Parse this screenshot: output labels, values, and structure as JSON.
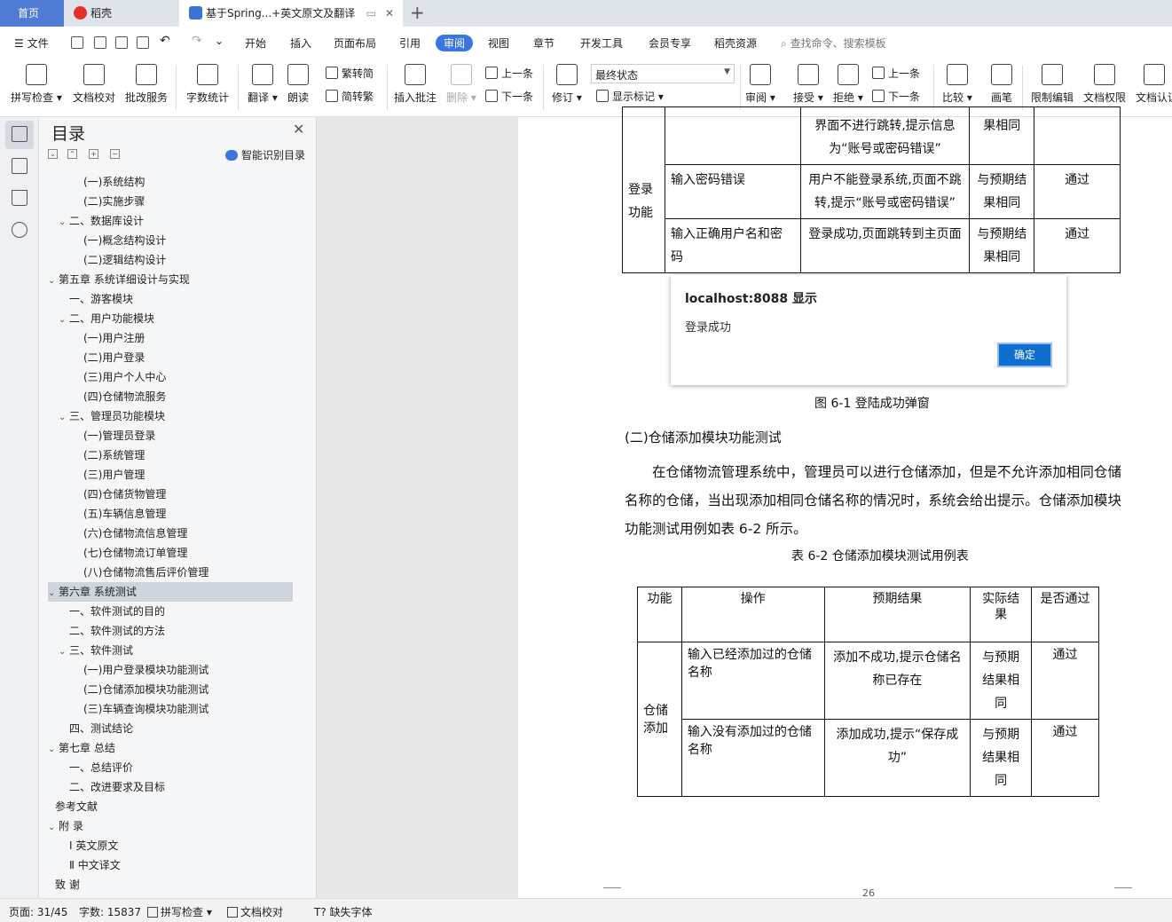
{
  "tabs": {
    "home": "首页",
    "docer": "稻壳",
    "doc": "基于Spring...+英文原文及翻译"
  },
  "menu": {
    "file": "文件",
    "items": [
      "开始",
      "插入",
      "页面布局",
      "引用",
      "审阅",
      "视图",
      "章节",
      "开发工具",
      "会员专享",
      "稻壳资源"
    ],
    "search_placeholder": "查找命令、搜索模板"
  },
  "ribbon": {
    "spell_check": "拼写检查",
    "doc_proof": "文档校对",
    "batch_service": "批改服务",
    "word_count": "字数统计",
    "translate": "翻译",
    "read_aloud": "朗读",
    "trad_conv": "繁转简",
    "simp_conv": "简转繁",
    "insert_comment": "插入批注",
    "delete": "删除",
    "prev_item": "上一条",
    "next_item": "下一条",
    "revise": "修订",
    "final_state": "最终状态",
    "show_marks": "显示标记",
    "review": "审阅",
    "accept": "接受",
    "reject": "拒绝",
    "prev_change": "上一条",
    "next_change": "下一条",
    "compare": "比较",
    "pen": "画笔",
    "restrict_edit": "限制编辑",
    "doc_rights": "文档权限",
    "doc_cert": "文档认证"
  },
  "toc": {
    "title": "目录",
    "smart": "智能识别目录",
    "items": [
      {
        "text": "(一)系统结构",
        "level": 3
      },
      {
        "text": "(二)实施步骤",
        "level": 3
      },
      {
        "text": "二、数据库设计",
        "level": 2,
        "chev": true
      },
      {
        "text": "(一)概念结构设计",
        "level": 3
      },
      {
        "text": "(二)逻辑结构设计",
        "level": 3
      },
      {
        "text": "第五章  系统详细设计与实现",
        "level": 1,
        "chev": true
      },
      {
        "text": "一、游客模块",
        "level": 2
      },
      {
        "text": "二、用户功能模块",
        "level": 2,
        "chev": true
      },
      {
        "text": "(一)用户注册",
        "level": 3
      },
      {
        "text": "(二)用户登录",
        "level": 3
      },
      {
        "text": "(三)用户个人中心",
        "level": 3
      },
      {
        "text": "(四)仓储物流服务",
        "level": 3
      },
      {
        "text": "三、管理员功能模块",
        "level": 2,
        "chev": true
      },
      {
        "text": "(一)管理员登录",
        "level": 3
      },
      {
        "text": "(二)系统管理",
        "level": 3
      },
      {
        "text": "(三)用户管理",
        "level": 3
      },
      {
        "text": "(四)仓储货物管理",
        "level": 3
      },
      {
        "text": "(五)车辆信息管理",
        "level": 3
      },
      {
        "text": "(六)仓储物流信息管理",
        "level": 3
      },
      {
        "text": "(七)仓储物流订单管理",
        "level": 3
      },
      {
        "text": "(八)仓储物流售后评价管理",
        "level": 3
      },
      {
        "text": "第六章  系统测试",
        "level": 1,
        "chev": true,
        "selected": true
      },
      {
        "text": "一、软件测试的目的",
        "level": 2
      },
      {
        "text": "二、软件测试的方法",
        "level": 2
      },
      {
        "text": "三、软件测试",
        "level": 2,
        "chev": true
      },
      {
        "text": "(一)用户登录模块功能测试",
        "level": 3
      },
      {
        "text": "(二)仓储添加模块功能测试",
        "level": 3
      },
      {
        "text": "(三)车辆查询模块功能测试",
        "level": 3
      },
      {
        "text": "四、测试结论",
        "level": 2
      },
      {
        "text": "第七章  总结",
        "level": 1,
        "chev": true
      },
      {
        "text": "一、总结评价",
        "level": 2
      },
      {
        "text": "二、改进要求及目标",
        "level": 2
      },
      {
        "text": "参考文献",
        "level": 1
      },
      {
        "text": "附    录",
        "level": 1,
        "chev": true
      },
      {
        "text": "Ⅰ 英文原文",
        "level": 2
      },
      {
        "text": "Ⅱ 中文译文",
        "level": 2
      },
      {
        "text": "致    谢",
        "level": 1
      }
    ]
  },
  "doc": {
    "t1": {
      "row0": [
        "",
        "界面不进行跳转,提示信息为“账号或密码错误”",
        "果相同",
        ""
      ],
      "func": "登录功能",
      "row1": [
        "输入密码错误",
        "用户不能登录系统,页面不跳转,提示“账号或密码错误”",
        "与预期结果相同",
        "通过"
      ],
      "row2": [
        "输入正确用户名和密码",
        "登录成功,页面跳转到主页面",
        "与预期结果相同",
        "通过"
      ]
    },
    "dialog": {
      "title": "localhost:8088 显示",
      "message": "登录成功",
      "ok": "确定"
    },
    "fig_caption": "图 6-1 登陆成功弹窗",
    "section": "(二)仓储添加模块功能测试",
    "paragraph": "在仓储物流管理系统中，管理员可以进行仓储添加，但是不允许添加相同仓储名称的仓储，当出现添加相同仓储名称的情况时，系统会给出提示。仓储添加模块功能测试用例如表 6-2 所示。",
    "table_caption": "表 6-2  仓储添加模块测试用例表",
    "t2": {
      "headers": [
        "功能",
        "操作",
        "预期结果",
        "实际结果",
        "是否通过"
      ],
      "func": "仓储添加",
      "row1": [
        "输入已经添加过的仓储名称",
        "添加不成功,提示仓储名称已存在",
        "与预期结果相同",
        "通过"
      ],
      "row2": [
        "输入没有添加过的仓储名称",
        "添加成功,提示“保存成功”",
        "与预期结果相同",
        "通过"
      ]
    },
    "page_number": "26"
  },
  "status": {
    "page": "页面: 31/45",
    "words": "字数: 15837",
    "spell": "拼写检查",
    "proof": "文档校对",
    "missing_font": "缺失字体"
  }
}
